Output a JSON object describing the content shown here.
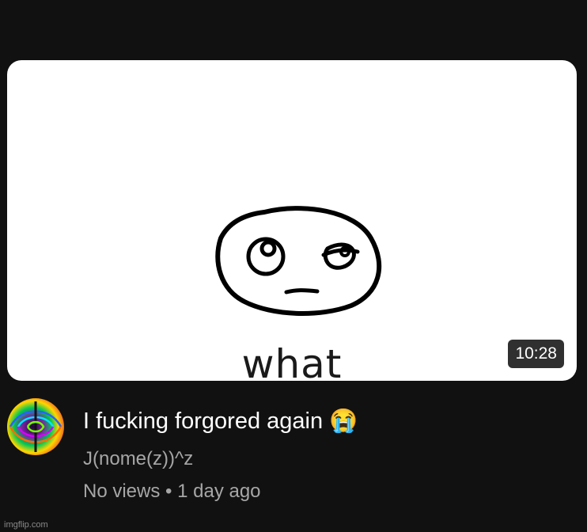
{
  "video": {
    "thumbnail_caption": "what",
    "duration": "10:28",
    "title": "I fucking forgored again 😭",
    "channel": "J(nome(z))^z",
    "views": "No views",
    "separator": "•",
    "age": "1 day ago"
  },
  "watermark": "imgflip.com"
}
